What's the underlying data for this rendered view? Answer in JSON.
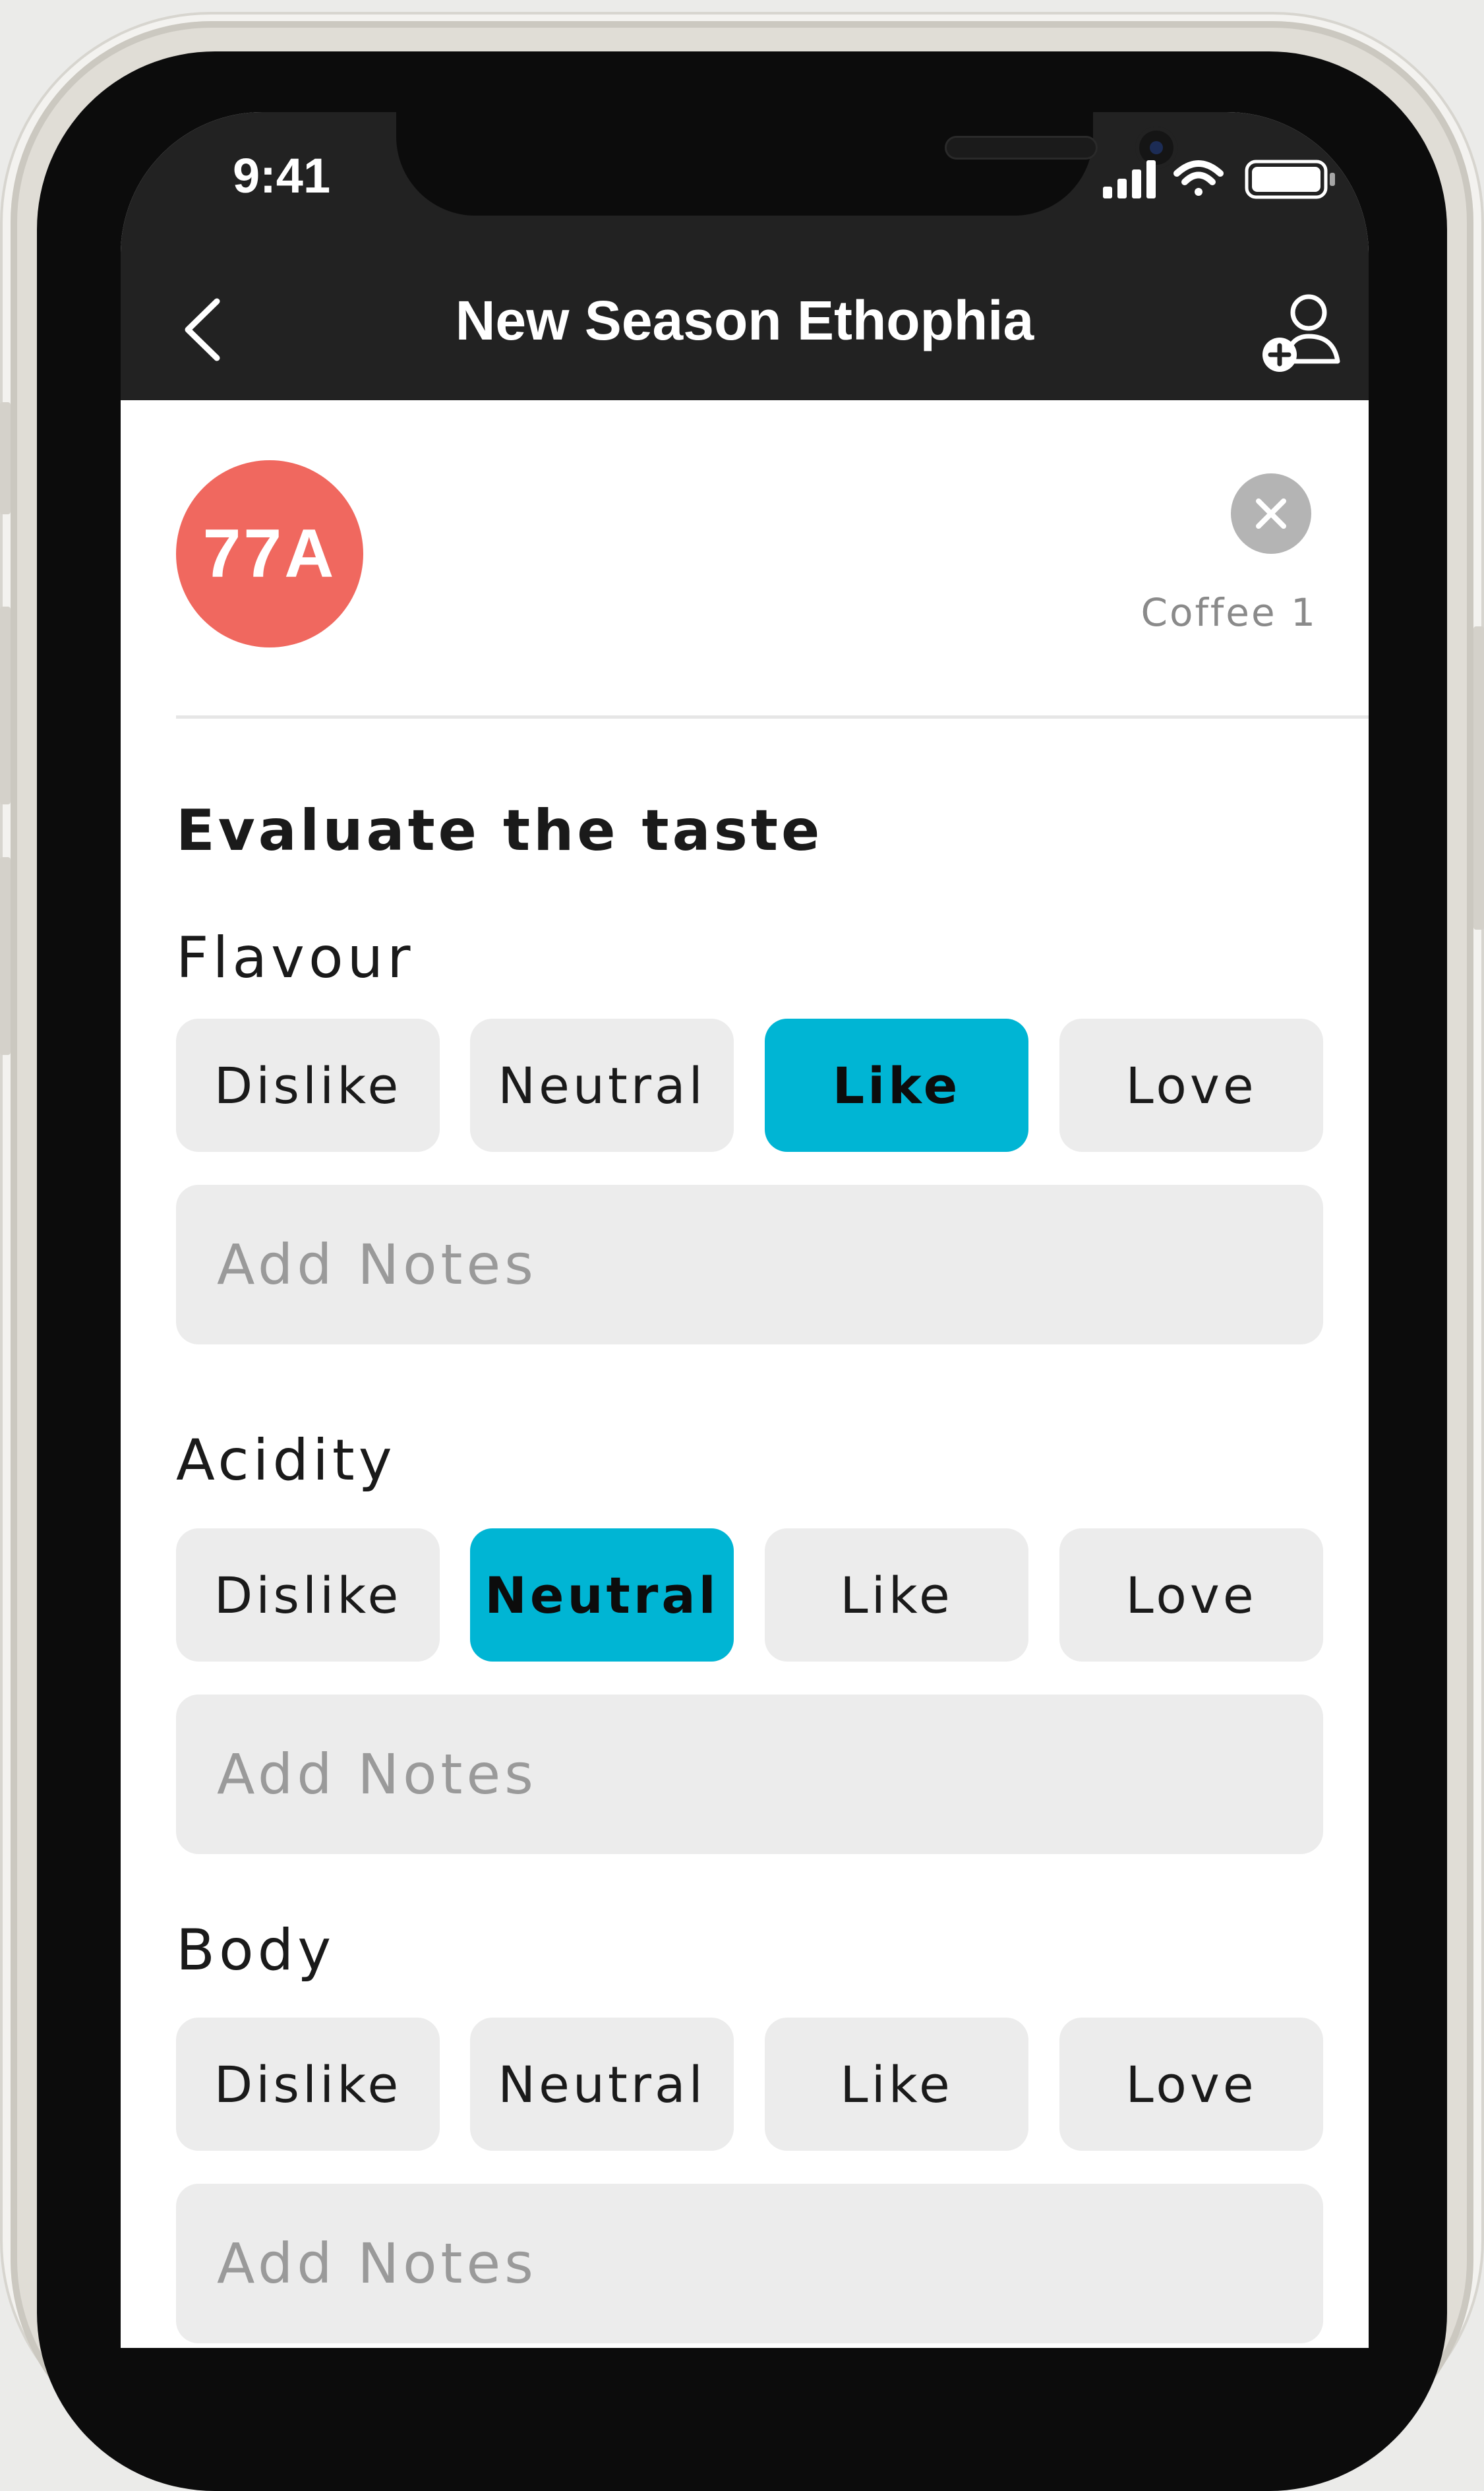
{
  "status_bar": {
    "time": "9:41"
  },
  "nav": {
    "title": "New Season Ethophia"
  },
  "coffee": {
    "code": "77A",
    "label": "Coffee 1"
  },
  "section_heading": "Evaluate the taste",
  "colors": {
    "selected": "#00b5d4",
    "badge": "#f0685f",
    "header": "#222222"
  },
  "categories": [
    {
      "label": "Flavour",
      "options": [
        "Dislike",
        "Neutral",
        "Like",
        "Love"
      ],
      "selected": "Like",
      "notes_placeholder": "Add Notes"
    },
    {
      "label": "Acidity",
      "options": [
        "Dislike",
        "Neutral",
        "Like",
        "Love"
      ],
      "selected": "Neutral",
      "notes_placeholder": "Add Notes"
    },
    {
      "label": "Body",
      "options": [
        "Dislike",
        "Neutral",
        "Like",
        "Love"
      ],
      "selected": null,
      "notes_placeholder": "Add Notes"
    }
  ]
}
